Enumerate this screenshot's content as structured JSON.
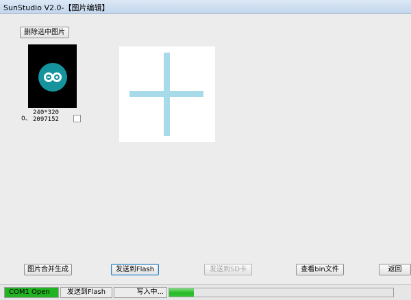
{
  "window": {
    "title": "SunStudio V2.0-【图片编辑】"
  },
  "toolbar": {
    "delete_selected_label": "删除选中图片"
  },
  "thumbnails": [
    {
      "index_label": "0、",
      "resolution": "240*320",
      "size": "2097152",
      "selected": false
    }
  ],
  "icons": {
    "logo": "infinity-logo-icon",
    "preview": "plus-icon"
  },
  "buttons": {
    "merge_label": "图片合并生成",
    "send_flash_label": "发送到Flash",
    "send_sd_label": "发送到SD卡",
    "view_bin_label": "查看bin文件",
    "back_label": "返回"
  },
  "status": {
    "com_label": "COM1 Open",
    "send_label": "发送到Flash",
    "write_label": "写入中...",
    "progress": 0.11
  },
  "colors": {
    "com_open": "#21b321",
    "logo": "#15949e",
    "plus": "#a8dbe9"
  }
}
